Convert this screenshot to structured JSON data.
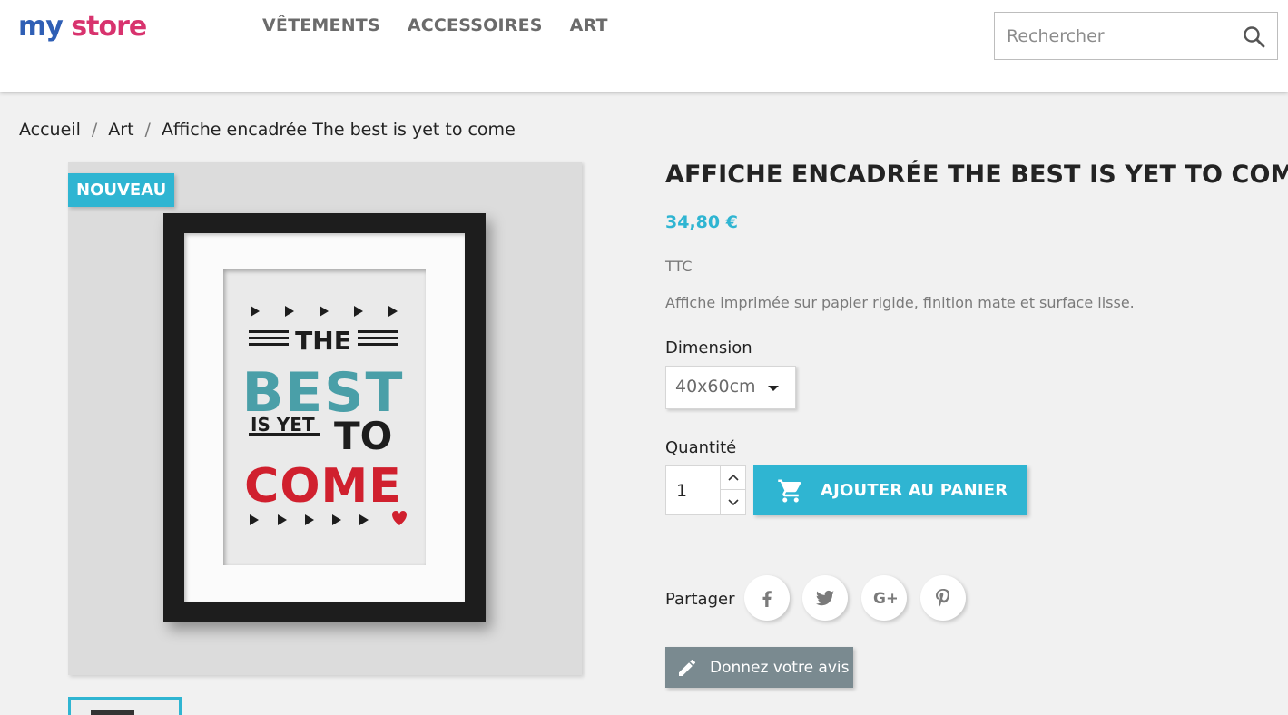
{
  "brand": {
    "logo_word1": "my",
    "logo_word2": "store"
  },
  "nav": {
    "items": [
      {
        "label": "VÊTEMENTS"
      },
      {
        "label": "ACCESSOIRES"
      },
      {
        "label": "ART"
      }
    ]
  },
  "search": {
    "placeholder": "Rechercher"
  },
  "breadcrumb": {
    "items": [
      {
        "label": "Accueil"
      },
      {
        "label": "Art"
      },
      {
        "label": "Affiche encadrée The best is yet to come"
      }
    ],
    "separator": "/"
  },
  "product": {
    "badge": "NOUVEAU",
    "title": "AFFICHE ENCADRÉE THE BEST IS YET TO COME",
    "price": "34,80 €",
    "tax_label": "TTC",
    "description": "Affiche imprimée sur papier rigide, finition mate et surface lisse.",
    "dimension_label": "Dimension",
    "dimension_value": "40x60cm",
    "quantity_label": "Quantité",
    "quantity_value": "1",
    "add_to_cart": "AJOUTER AU PANIER",
    "share_label": "Partager",
    "review_button": "Donnez votre avis"
  },
  "poster": {
    "line1": "THE",
    "line2": "BEST",
    "line3a": "IS YET",
    "line3b": "TO",
    "line4": "COME"
  },
  "colors": {
    "accent": "#2fb5d2",
    "review_bg": "#7a8a90",
    "poster_teal": "#4a9fa8",
    "poster_red": "#d0202e"
  }
}
